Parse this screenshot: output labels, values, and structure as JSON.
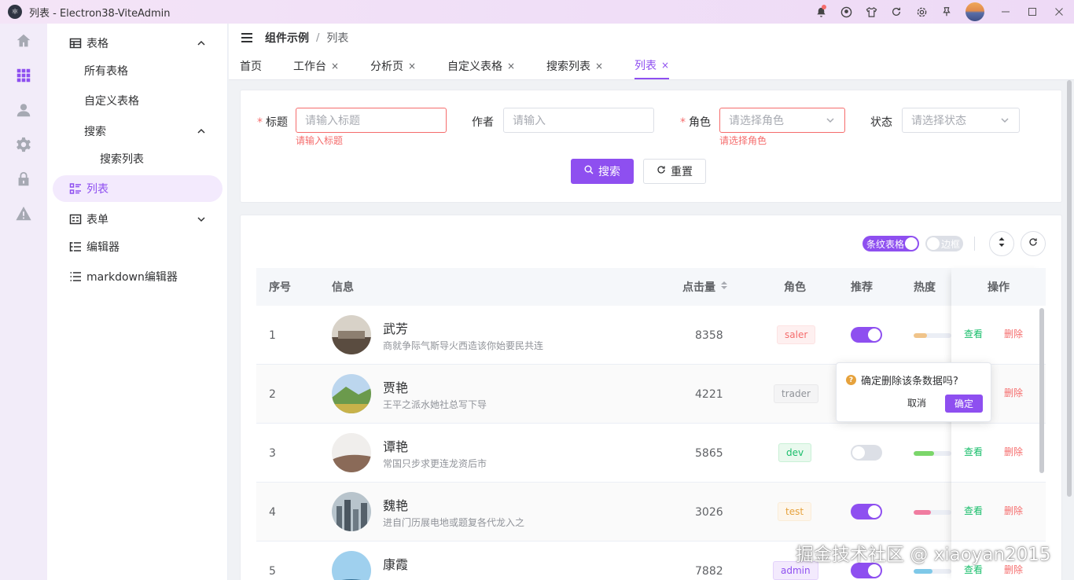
{
  "window": {
    "title": "列表 - Electron38-ViteAdmin",
    "logo": "electron-logo"
  },
  "colors": {
    "accent": "#8e4ff0",
    "danger": "#f56c6c",
    "success": "#19be6b"
  },
  "breadcrumb": {
    "parent": "组件示例",
    "separator": "/",
    "current": "列表"
  },
  "tabs": [
    {
      "label": "首页",
      "closable": false
    },
    {
      "label": "工作台",
      "closable": true
    },
    {
      "label": "分析页",
      "closable": true
    },
    {
      "label": "自定义表格",
      "closable": true
    },
    {
      "label": "搜索列表",
      "closable": true
    },
    {
      "label": "列表",
      "closable": true,
      "active": true
    }
  ],
  "tab_close_glyph": "×",
  "sidebar": {
    "items": [
      {
        "label": "表格",
        "icon": "table-icon",
        "expanded": true
      },
      {
        "label": "所有表格"
      },
      {
        "label": "自定义表格"
      },
      {
        "label": "搜索",
        "expanded": true
      },
      {
        "label": "搜索列表"
      },
      {
        "label": "列表",
        "icon": "list-icon",
        "active": true
      },
      {
        "label": "表单",
        "icon": "form-icon",
        "expanded": false
      },
      {
        "label": "编辑器",
        "icon": "editor-icon"
      },
      {
        "label": "markdown编辑器",
        "icon": "markdown-icon"
      }
    ]
  },
  "search_form": {
    "title": {
      "label": "标题",
      "required": true,
      "placeholder": "请输入标题",
      "error": "请输入标题"
    },
    "author": {
      "label": "作者",
      "placeholder": "请输入"
    },
    "role": {
      "label": "角色",
      "required": true,
      "placeholder": "请选择角色",
      "error": "请选择角色"
    },
    "status": {
      "label": "状态",
      "placeholder": "请选择状态"
    },
    "required_mark": "*",
    "search_label": "搜索",
    "reset_label": "重置"
  },
  "table_controls": {
    "stripe_label": "条纹表格",
    "stripe_on": true,
    "border_label": "边框",
    "border_on": false
  },
  "table": {
    "columns": [
      "序号",
      "信息",
      "点击量",
      "角色",
      "推荐",
      "热度",
      "操作"
    ],
    "rows": [
      {
        "index": "1",
        "name": "武芳",
        "desc": "商就争际气斯导火西造该你始要民共连",
        "clicks": "8358",
        "role": "saler",
        "recommend": true,
        "heat": 0.35,
        "heat_color": "#f0c48a"
      },
      {
        "index": "2",
        "name": "贾艳",
        "desc": "王平之派水她社总写下导",
        "clicks": "4221",
        "role": "trader",
        "recommend": true,
        "heat": 0.5,
        "heat_color": "#8e4ff0"
      },
      {
        "index": "3",
        "name": "谭艳",
        "desc": "常国只步求更连龙资后市",
        "clicks": "5865",
        "role": "dev",
        "recommend": false,
        "heat": 0.55,
        "heat_color": "#7bd66a"
      },
      {
        "index": "4",
        "name": "魏艳",
        "desc": "进自门历展电地或题复各代龙入之",
        "clicks": "3026",
        "role": "test",
        "recommend": true,
        "heat": 0.45,
        "heat_color": "#f07ca0"
      },
      {
        "index": "5",
        "name": "康霞",
        "desc": "",
        "clicks": "7882",
        "role": "admin",
        "recommend": true,
        "heat": 0.5,
        "heat_color": "#7ec8e8"
      }
    ],
    "actions": {
      "view": "查看",
      "delete": "删除"
    }
  },
  "popconfirm": {
    "icon": "warning-icon",
    "glyph": "?",
    "message": "确定删除该条数据吗?",
    "cancel": "取消",
    "confirm": "确定"
  },
  "watermark": "掘金技术社区 @ xiaoyan2015"
}
